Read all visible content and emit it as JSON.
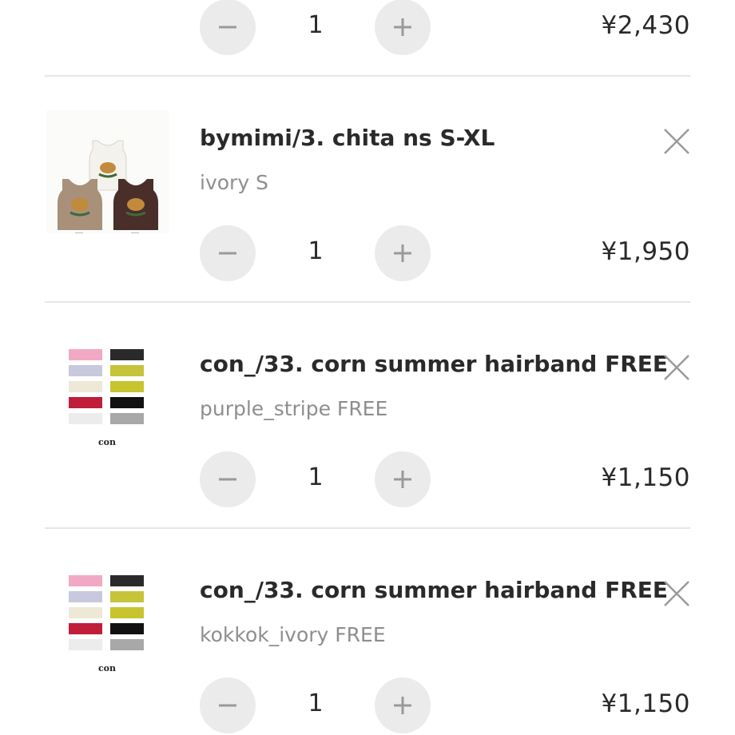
{
  "cart": {
    "top_item": {
      "quantity": "1",
      "price": "¥2,430"
    },
    "items": [
      {
        "title": "bymimi/3. chita ns S-XL",
        "variant": "ivory S",
        "quantity": "1",
        "price": "¥1,950",
        "thumbnail": "cheetah-tank-tops-image"
      },
      {
        "title": "con_/33. corn summer hairband FREE",
        "variant": "purple_stripe FREE",
        "quantity": "1",
        "price": "¥1,150",
        "thumbnail": "hairbands-image",
        "thumbnail_label": "con"
      },
      {
        "title": "con_/33. corn summer hairband FREE",
        "variant": "kokkok_ivory FREE",
        "quantity": "1",
        "price": "¥1,150",
        "thumbnail": "hairbands-image",
        "thumbnail_label": "con"
      }
    ]
  },
  "icons": {
    "remove": "close-icon",
    "decrease": "minus-icon",
    "increase": "plus-icon"
  },
  "colors": {
    "button_bg": "#ebebeb",
    "text": "#2a2a2a",
    "muted_text": "#8e8e8e",
    "divider": "#e6e6e6"
  }
}
